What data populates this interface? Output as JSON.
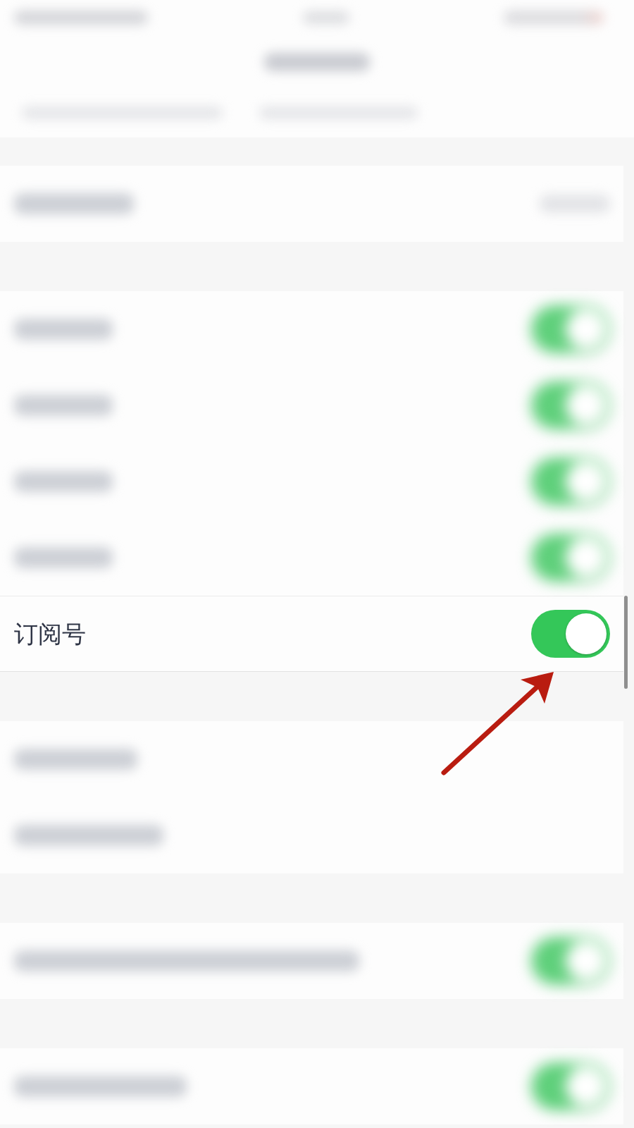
{
  "header": {
    "kind": "blurred"
  },
  "groups": [
    {
      "rows": [
        {
          "kind": "blurred_value"
        }
      ]
    },
    {
      "rows": [
        {
          "kind": "blurred_toggle",
          "on": true
        },
        {
          "kind": "blurred_toggle",
          "on": true
        },
        {
          "kind": "blurred_toggle",
          "on": true
        },
        {
          "kind": "blurred_toggle",
          "on": true
        },
        {
          "kind": "toggle",
          "label": "订阅号",
          "on": true
        }
      ]
    },
    {
      "rows": [
        {
          "kind": "blurred_text"
        },
        {
          "kind": "blurred_text"
        }
      ]
    },
    {
      "rows": [
        {
          "kind": "blurred_toggle",
          "on": true
        }
      ]
    },
    {
      "rows": [
        {
          "kind": "blurred_toggle",
          "on": true
        }
      ]
    }
  ],
  "annotations": [
    {
      "kind": "arrow"
    }
  ]
}
